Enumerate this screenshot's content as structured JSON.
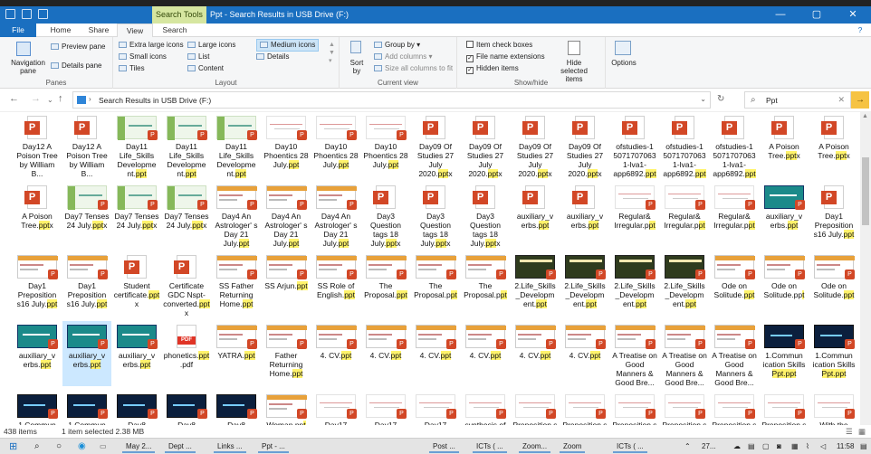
{
  "titlebar": {
    "context_tab": "Search Tools",
    "title": "Ppt - Search Results in USB Drive (F:)",
    "minimize": "—",
    "maximize": "▢",
    "close": "✕"
  },
  "tabs": {
    "file": "File",
    "home": "Home",
    "share": "Share",
    "view": "View",
    "search": "Search"
  },
  "ribbon": {
    "panes": {
      "navigation_pane": "Navigation pane",
      "preview_pane": "Preview pane",
      "details_pane": "Details pane",
      "label": "Panes"
    },
    "layout": {
      "extra_large": "Extra large icons",
      "large": "Large icons",
      "medium": "Medium icons",
      "small": "Small icons",
      "list": "List",
      "details": "Details",
      "tiles": "Tiles",
      "content": "Content",
      "label": "Layout"
    },
    "current_view": {
      "sort_by": "Sort by",
      "group_by": "Group by",
      "add_columns": "Add columns",
      "size_all": "Size all columns to fit",
      "label": "Current view"
    },
    "show_hide": {
      "item_check_boxes": "Item check boxes",
      "file_name_extensions": "File name extensions",
      "hidden_items": "Hidden items",
      "hide_selected": "Hide selected items",
      "label": "Show/hide"
    },
    "options": "Options"
  },
  "address": {
    "path": "Search Results in USB Drive (F:)",
    "search_value": "Ppt"
  },
  "files": [
    {
      "pre": "Day12 A Poison Tree by William B...",
      "hl": "",
      "post": "",
      "thumb": "ppt"
    },
    {
      "pre": "Day12 A Poison Tree by William B...",
      "hl": "",
      "post": "",
      "thumb": "ppt"
    },
    {
      "pre": "Day11 Life_Skills Developme nt.",
      "hl": "ppt",
      "post": "",
      "thumb": "green"
    },
    {
      "pre": "Day11 Life_Skills Developme nt.",
      "hl": "ppt",
      "post": "",
      "thumb": "green"
    },
    {
      "pre": "Day11 Life_Skills Developme nt.",
      "hl": "ppt",
      "post": "",
      "thumb": "green"
    },
    {
      "pre": "Day10 Phoentics 28 July.",
      "hl": "ppt",
      "post": "",
      "thumb": "plain"
    },
    {
      "pre": "Day10 Phoentics 28 July.",
      "hl": "ppt",
      "post": "",
      "thumb": "plain"
    },
    {
      "pre": "Day10 Phoentics 28 July.",
      "hl": "ppt",
      "post": "",
      "thumb": "plain"
    },
    {
      "pre": "Day09 Of Studies 27 July 2020.",
      "hl": "ppt",
      "post": "x",
      "thumb": "ppt"
    },
    {
      "pre": "Day09 Of Studies 27 July 2020.",
      "hl": "ppt",
      "post": "x",
      "thumb": "ppt"
    },
    {
      "pre": "Day09 Of Studies 27 July 2020.",
      "hl": "ppt",
      "post": "x",
      "thumb": "ppt"
    },
    {
      "pre": "Day09 Of Studies 27 July 2020.",
      "hl": "ppt",
      "post": "x",
      "thumb": "ppt"
    },
    {
      "pre": "ofstudies-1 5071707063 1-lva1- app6892.",
      "hl": "ppt",
      "post": "",
      "thumb": "ppt"
    },
    {
      "pre": "ofstudies-1 5071707063 1-lva1- app6892.",
      "hl": "ppt",
      "post": "",
      "thumb": "ppt"
    },
    {
      "pre": "ofstudies-1 5071707063 1-lva1- app6892.",
      "hl": "ppt",
      "post": "",
      "thumb": "ppt"
    },
    {
      "pre": "A Poison Tree.",
      "hl": "ppt",
      "post": "x",
      "thumb": "ppt"
    },
    {
      "pre": "A Poison Tree.",
      "hl": "ppt",
      "post": "x",
      "thumb": "ppt"
    },
    {
      "pre": "A Poison Tree.",
      "hl": "ppt",
      "post": "x",
      "thumb": "ppt"
    },
    {
      "pre": "Day7 Tenses 24 July.",
      "hl": "ppt",
      "post": "x",
      "thumb": "green"
    },
    {
      "pre": "Day7 Tenses 24 July.",
      "hl": "ppt",
      "post": "x",
      "thumb": "green"
    },
    {
      "pre": "Day7 Tenses 24 July.",
      "hl": "ppt",
      "post": "x",
      "thumb": "green"
    },
    {
      "pre": "Day4 An Astrologer' s Day 21 July.",
      "hl": "ppt",
      "post": "",
      "thumb": "slide"
    },
    {
      "pre": "Day4 An Astrologer' s Day 21 July.",
      "hl": "ppt",
      "post": "",
      "thumb": "slide"
    },
    {
      "pre": "Day4 An Astrologer' s Day 21 July.",
      "hl": "ppt",
      "post": "",
      "thumb": "slide"
    },
    {
      "pre": "Day3 Question tags 18 July.",
      "hl": "ppt",
      "post": "x",
      "thumb": "ppt"
    },
    {
      "pre": "Day3 Question tags 18 July.",
      "hl": "ppt",
      "post": "x",
      "thumb": "ppt"
    },
    {
      "pre": "Day3 Question tags 18 July.",
      "hl": "ppt",
      "post": "x",
      "thumb": "ppt"
    },
    {
      "pre": "auxiliary_v erbs.",
      "hl": "ppt",
      "post": "",
      "thumb": "ppt"
    },
    {
      "pre": "auxiliary_v erbs.",
      "hl": "ppt",
      "post": "",
      "thumb": "ppt"
    },
    {
      "pre": "Regular& Irregular.p",
      "hl": "pt",
      "post": "",
      "thumb": "plain"
    },
    {
      "pre": "Regular& Irregular.p",
      "hl": "pt",
      "post": "",
      "thumb": "plain"
    },
    {
      "pre": "Regular& Irregular.p",
      "hl": "pt",
      "post": "",
      "thumb": "plain"
    },
    {
      "pre": "auxiliary_v erbs.",
      "hl": "ppt",
      "post": "",
      "thumb": "teal"
    },
    {
      "pre": "Day1 Preposition s16 July.",
      "hl": "ppt",
      "post": "",
      "thumb": "ppt"
    },
    {
      "pre": "Day1 Preposition s16 July.",
      "hl": "ppt",
      "post": "",
      "thumb": "slide"
    },
    {
      "pre": "Day1 Preposition s16 July.",
      "hl": "ppt",
      "post": "",
      "thumb": "slide"
    },
    {
      "pre": "Student certificate.",
      "hl": "ppt",
      "post": "x",
      "thumb": "ppt"
    },
    {
      "pre": "Certificate GDC Nspt- converted.",
      "hl": "ppt",
      "post": "x",
      "thumb": "ppt"
    },
    {
      "pre": "SS Father Returning Home.",
      "hl": "ppt",
      "post": "",
      "thumb": "slide"
    },
    {
      "pre": "SS Arjun.",
      "hl": "ppt",
      "post": "",
      "thumb": "slide"
    },
    {
      "pre": "SS Role of English.",
      "hl": "ppt",
      "post": "",
      "thumb": "slide"
    },
    {
      "pre": "The Proposal.",
      "hl": "ppt",
      "post": "",
      "thumb": "slide"
    },
    {
      "pre": "The Proposal.p",
      "hl": "pt",
      "post": "",
      "thumb": "slide"
    },
    {
      "pre": "The Proposal.p",
      "hl": "pt",
      "post": "",
      "thumb": "slide"
    },
    {
      "pre": "2.Life_Skills _Developm ent.",
      "hl": "ppt",
      "post": "",
      "thumb": "dark"
    },
    {
      "pre": "2.Life_Skills _Developm ent.",
      "hl": "ppt",
      "post": "",
      "thumb": "dark"
    },
    {
      "pre": "2.Life_Skills _Developm ent.",
      "hl": "ppt",
      "post": "",
      "thumb": "dark"
    },
    {
      "pre": "2.Life_Skills _Developm ent.",
      "hl": "ppt",
      "post": "",
      "thumb": "dark"
    },
    {
      "pre": "Ode on Solitude.",
      "hl": "ppt",
      "post": "",
      "thumb": "slide"
    },
    {
      "pre": "Ode on Solitude.pp",
      "hl": "t",
      "post": "",
      "thumb": "slide"
    },
    {
      "pre": "Ode on Solitude.",
      "hl": "ppt",
      "post": "",
      "thumb": "slide"
    },
    {
      "pre": "auxiliary_v erbs.",
      "hl": "ppt",
      "post": "",
      "thumb": "teal"
    },
    {
      "pre": "auxiliary_v erbs.",
      "hl": "ppt",
      "post": "",
      "thumb": "teal"
    },
    {
      "pre": "auxiliary_v erbs.",
      "hl": "ppt",
      "post": "",
      "thumb": "teal"
    },
    {
      "pre": "phonetics.",
      "hl": "ppt",
      "post": ".pdf",
      "thumb": "pdf"
    },
    {
      "pre": "YATRA.",
      "hl": "ppt",
      "post": "",
      "thumb": "slide"
    },
    {
      "pre": "Father Returning Home.",
      "hl": "ppt",
      "post": "",
      "thumb": "slide"
    },
    {
      "pre": "4. CV.",
      "hl": "ppt",
      "post": "",
      "thumb": "slide"
    },
    {
      "pre": "4. CV.",
      "hl": "ppt",
      "post": "",
      "thumb": "slide"
    },
    {
      "pre": "4. CV.",
      "hl": "ppt",
      "post": "",
      "thumb": "slide"
    },
    {
      "pre": "4. CV.",
      "hl": "ppt",
      "post": "",
      "thumb": "slide"
    },
    {
      "pre": "4. CV.",
      "hl": "ppt",
      "post": "",
      "thumb": "slide"
    },
    {
      "pre": "4. CV.",
      "hl": "ppt",
      "post": "",
      "thumb": "slide"
    },
    {
      "pre": "A Treatise on Good Manners & Good Bre...",
      "hl": "",
      "post": "",
      "thumb": "slide"
    },
    {
      "pre": "A Treatise on Good Manners & Good Bre...",
      "hl": "",
      "post": "",
      "thumb": "slide"
    },
    {
      "pre": "A Treatise on Good Manners & Good Bre...",
      "hl": "",
      "post": "",
      "thumb": "slide"
    },
    {
      "pre": "1.Commun ication Skills ",
      "hl": "Ppt.ppt",
      "post": "",
      "thumb": "navy"
    },
    {
      "pre": "1.Commun ication Skills ",
      "hl": "Ppt.ppt",
      "post": "",
      "thumb": "navy"
    },
    {
      "pre": "1.Commun ication",
      "hl": "",
      "post": "",
      "thumb": "navy"
    },
    {
      "pre": "1.Commun ication",
      "hl": "",
      "post": "",
      "thumb": "navy"
    },
    {
      "pre": "Day8 Communic",
      "hl": "",
      "post": "",
      "thumb": "navy"
    },
    {
      "pre": "Day8 Communic",
      "hl": "",
      "post": "",
      "thumb": "navy"
    },
    {
      "pre": "Day8 Communic",
      "hl": "",
      "post": "",
      "thumb": "navy"
    },
    {
      "pre": "Woman.pp",
      "hl": "t",
      "post": "",
      "thumb": "slide"
    },
    {
      "pre": "Day17 synthesis",
      "hl": "",
      "post": "",
      "thumb": "plain"
    },
    {
      "pre": "Day17 synthesis",
      "hl": "",
      "post": "",
      "thumb": "plain"
    },
    {
      "pre": "Day17 synthesis",
      "hl": "",
      "post": "",
      "thumb": "plain"
    },
    {
      "pre": "synthesis of",
      "hl": "",
      "post": "",
      "thumb": "plain"
    },
    {
      "pre": "Preposition s DrASrinat",
      "hl": "",
      "post": "",
      "thumb": "plain"
    },
    {
      "pre": "Preposition s DrASrinat",
      "hl": "",
      "post": "",
      "thumb": "plain"
    },
    {
      "pre": "Preposition s DrASrinat",
      "hl": "",
      "post": "",
      "thumb": "plain"
    },
    {
      "pre": "Preposition s DrASrinat",
      "hl": "",
      "post": "",
      "thumb": "plain"
    },
    {
      "pre": "Preposition s DrASrinat",
      "hl": "",
      "post": "",
      "thumb": "plain"
    },
    {
      "pre": "Preposition s DrASrinat",
      "hl": "",
      "post": "",
      "thumb": "plain"
    },
    {
      "pre": "With the Photograp",
      "hl": "",
      "post": "",
      "thumb": "plain"
    }
  ],
  "selected_index": 52,
  "status": {
    "count": "438 items",
    "selected": "1 item selected 2.38 MB"
  },
  "taskbar": {
    "apps": [
      "May 2...",
      "Dept ...",
      "Links ...",
      "Ppt - ...",
      "Post ...",
      "ICTs ( ...",
      "Zoom...",
      "Zoom",
      "ICTs ( ..."
    ],
    "time": "11:58",
    "tray_num": "27..."
  }
}
